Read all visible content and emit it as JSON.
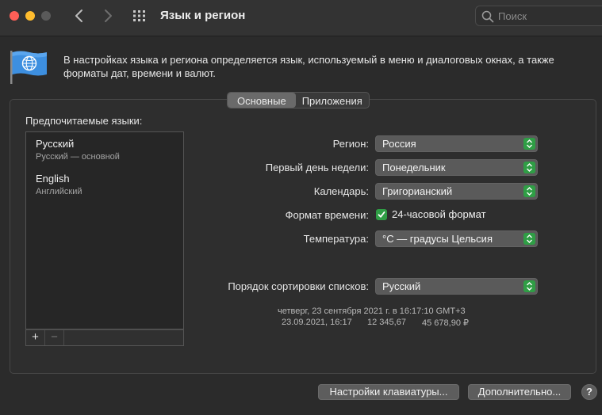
{
  "window": {
    "title": "Язык и регион",
    "search_placeholder": "Поиск"
  },
  "description": "В настройках языка и региона определяется язык, используемый в меню и диалоговых окнах, а также форматы дат, времени и валют.",
  "tabs": [
    {
      "label": "Основные",
      "active": true
    },
    {
      "label": "Приложения",
      "active": false
    }
  ],
  "languages": {
    "header": "Предпочитаемые языки:",
    "items": [
      {
        "name": "Русский",
        "subtitle": "Русский — основной"
      },
      {
        "name": "English",
        "subtitle": "Английский"
      }
    ],
    "add_label": "+",
    "remove_label": "−"
  },
  "settings": {
    "region": {
      "label": "Регион:",
      "value": "Россия"
    },
    "first_day": {
      "label": "Первый день недели:",
      "value": "Понедельник"
    },
    "calendar": {
      "label": "Календарь:",
      "value": "Григорианский"
    },
    "time_format": {
      "label": "Формат времени:",
      "checkbox_label": "24-часовой формат",
      "checked": true
    },
    "temperature": {
      "label": "Температура:",
      "value": "°C — градусы Цельсия"
    },
    "sort_order": {
      "label": "Порядок сортировки списков:",
      "value": "Русский"
    }
  },
  "sample": {
    "long_date": "четверг, 23 сентября 2021 г. в 16:17:10 GMT+3",
    "short_date": "23.09.2021, 16:17",
    "number": "12 345,67",
    "currency": "45 678,90 ₽"
  },
  "footer": {
    "keyboard_button": "Настройки клавиатуры...",
    "advanced_button": "Дополнительно...",
    "help_label": "?"
  },
  "colors": {
    "accent_green": "#2f9e45",
    "close": "#ff5f57",
    "minimize": "#febc2e"
  }
}
